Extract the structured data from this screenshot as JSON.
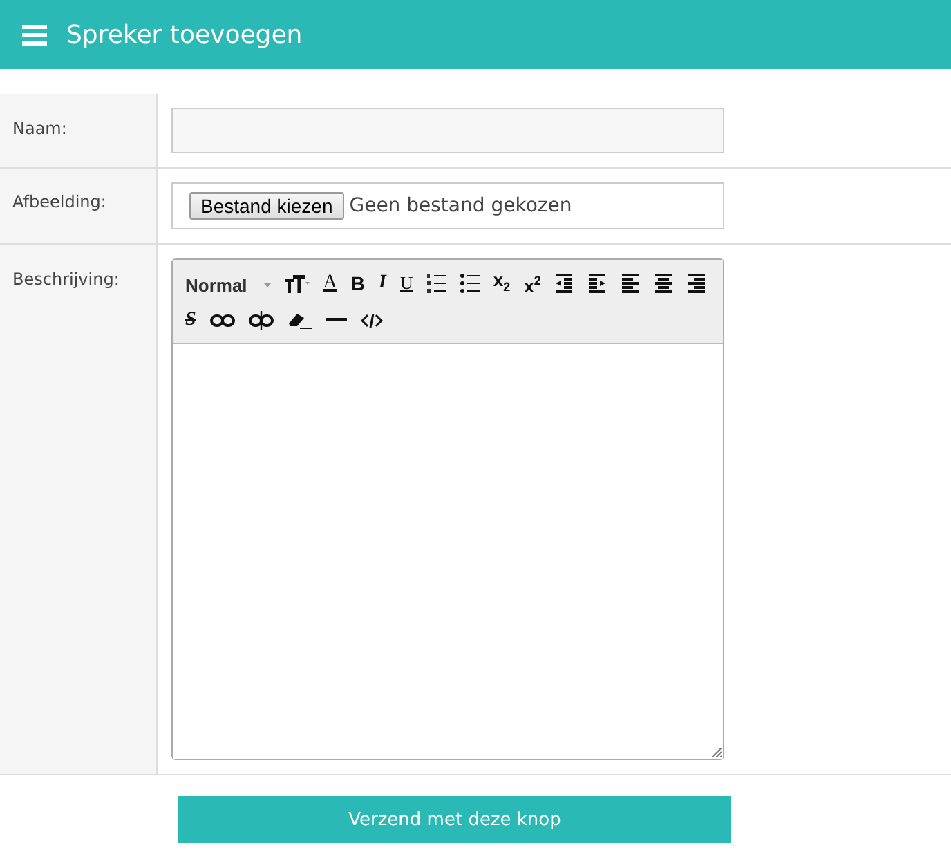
{
  "header": {
    "title": "Spreker toevoegen"
  },
  "fields": [
    {
      "kind": "text",
      "label": "Naam:"
    },
    {
      "kind": "file",
      "label": "Afbeelding:",
      "button": "Bestand kiezen",
      "status": "Geen bestand gekozen"
    },
    {
      "kind": "editor",
      "label": "Beschrijving:"
    }
  ],
  "toolbar": [
    {
      "kind": "format",
      "label": "Normal"
    },
    {
      "kind": "fontsize"
    },
    {
      "kind": "fontcolor",
      "label": "A"
    },
    {
      "kind": "bold",
      "label": "B"
    },
    {
      "kind": "italic",
      "label": "I"
    },
    {
      "kind": "underline",
      "label": "U"
    },
    {
      "kind": "olist"
    },
    {
      "kind": "ulist"
    },
    {
      "kind": "script",
      "label": "x$_{2}$"
    },
    {
      "kind": "script",
      "label": "x$^{2}$"
    },
    {
      "kind": "outdent"
    },
    {
      "kind": "indent"
    },
    {
      "kind": "alignleft"
    },
    {
      "kind": "aligncenter"
    },
    {
      "kind": "alignright"
    },
    {
      "kind": "strike",
      "label": "S"
    },
    {
      "kind": "link"
    },
    {
      "kind": "unlink"
    },
    {
      "kind": "eraser"
    },
    {
      "kind": "rule"
    },
    {
      "kind": "code"
    }
  ],
  "submit": "Verzend met deze knop"
}
